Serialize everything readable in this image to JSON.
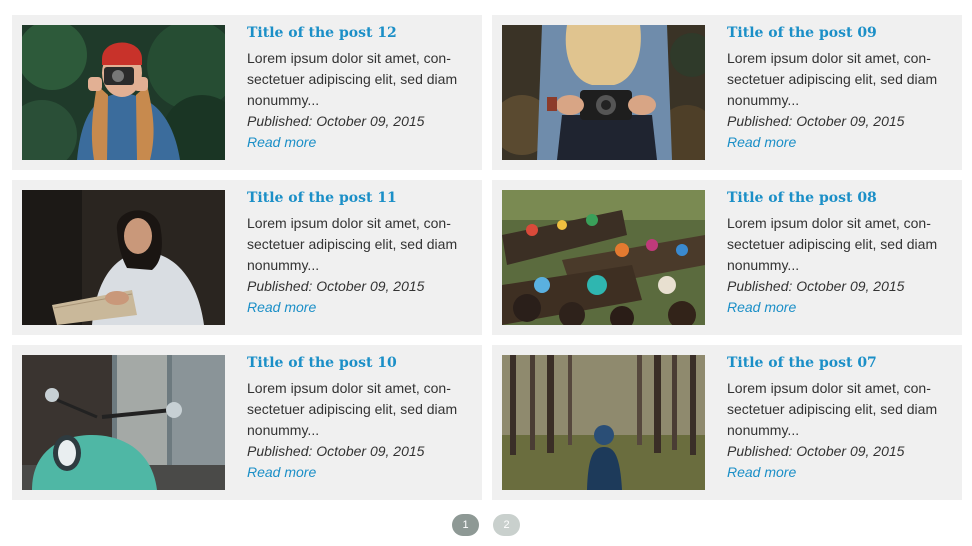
{
  "posts": [
    {
      "title": "Title of the post 12",
      "excerpt": "Lorem ipsum dolor sit amet, con-sectetuer adipiscing elit, sed diam nonummy...",
      "published": "Published: October 09, 2015",
      "read_more": "Read more",
      "image": "woman-with-camera-red-hat"
    },
    {
      "title": "Title of the post 09",
      "excerpt": "Lorem ipsum dolor sit amet, con-sectetuer adipiscing elit, sed diam nonummy...",
      "published": "Published: October 09, 2015",
      "read_more": "Read more",
      "image": "hands-holding-camera"
    },
    {
      "title": "Title of the post 11",
      "excerpt": "Lorem ipsum dolor sit amet, con-sectetuer adipiscing elit, sed diam nonummy...",
      "published": "Published: October 09, 2015",
      "read_more": "Read more",
      "image": "woman-reading"
    },
    {
      "title": "Title of the post 08",
      "excerpt": "Lorem ipsum dolor sit amet, con-sectetuer adipiscing elit, sed diam nonummy...",
      "published": "Published: October 09, 2015",
      "read_more": "Read more",
      "image": "floating-market-boats"
    },
    {
      "title": "Title of the post 10",
      "excerpt": "Lorem ipsum dolor sit amet, con-sectetuer adipiscing elit, sed diam nonummy...",
      "published": "Published: October 09, 2015",
      "read_more": "Read more",
      "image": "teal-scooter"
    },
    {
      "title": "Title of the post 07",
      "excerpt": "Lorem ipsum dolor sit amet, con-sectetuer adipiscing elit, sed diam nonummy...",
      "published": "Published: October 09, 2015",
      "read_more": "Read more",
      "image": "person-in-forest"
    }
  ],
  "pagination": {
    "pages": [
      "1",
      "2"
    ],
    "current": "1"
  },
  "colors": {
    "link": "#1b8fc7",
    "card_bg": "#f0f0f0",
    "page_active": "#8e9995",
    "page_inactive": "#c9d0cd"
  }
}
